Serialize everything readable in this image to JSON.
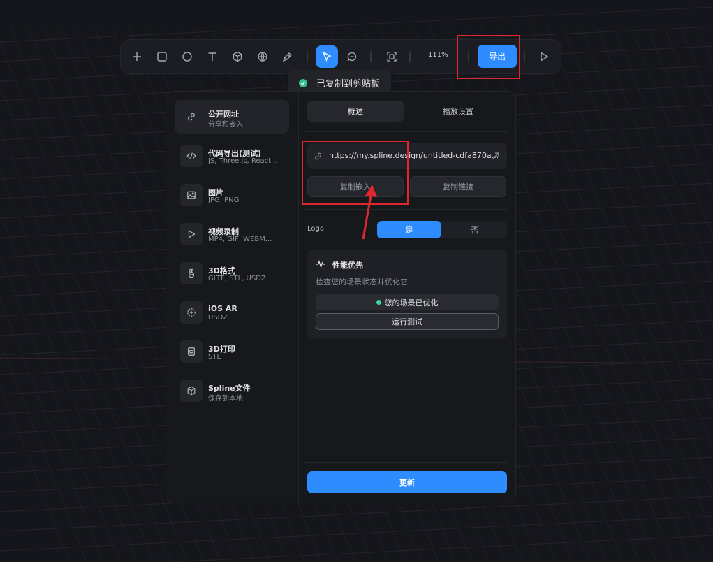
{
  "toolbar": {
    "tools": [
      "plus-icon",
      "rectangle-icon",
      "circle-icon",
      "text-icon",
      "cube-icon",
      "globe-icon",
      "pen-icon",
      "pointer-icon",
      "comment-icon",
      "frame-icon"
    ],
    "active_tool": "pointer-icon",
    "zoom": "111%",
    "export_label": "导出",
    "play_icon": "play-icon",
    "accent_color": "#2f8cff"
  },
  "toast": {
    "text": "已复制到剪贴板",
    "icon": "check-circle-icon"
  },
  "sidebar": {
    "items": [
      {
        "title": "公开网址",
        "subtitle": "分享和嵌入",
        "icon": "link-icon",
        "selected": true
      },
      {
        "title": "代码导出(测试)",
        "subtitle": "JS, Three.js, React...",
        "icon": "code-icon"
      },
      {
        "title": "图片",
        "subtitle": "JPG, PNG",
        "icon": "image-icon"
      },
      {
        "title": "视频录制",
        "subtitle": "MP4, GIF, WEBM...",
        "icon": "play-icon"
      },
      {
        "title": "3D格式",
        "subtitle": "GLTF, STL, USDZ",
        "icon": "rabbit-icon"
      },
      {
        "title": "iOS AR",
        "subtitle": "USDZ",
        "icon": "ar-icon"
      },
      {
        "title": "3D打印",
        "subtitle": "STL",
        "icon": "printer-icon"
      },
      {
        "title": "Spline文件",
        "subtitle": "保存到本地",
        "icon": "box-icon"
      }
    ]
  },
  "main": {
    "tabs": [
      {
        "label": "概述",
        "selected": true
      },
      {
        "label": "播放设置"
      }
    ],
    "url": "https://my.spline.design/untitled-cdfa870a...",
    "copy_embed_label": "复制嵌入",
    "copy_link_label": "复制链接",
    "logo_label": "Logo",
    "logo_options": [
      {
        "label": "是",
        "selected": true
      },
      {
        "label": "否"
      }
    ],
    "performance": {
      "title": "性能优先",
      "description": "检查您的场景状态并优化它",
      "status": "您的场景已优化",
      "status_color": "#3ed4a1",
      "run_label": "运行测试"
    },
    "update_label": "更新"
  }
}
